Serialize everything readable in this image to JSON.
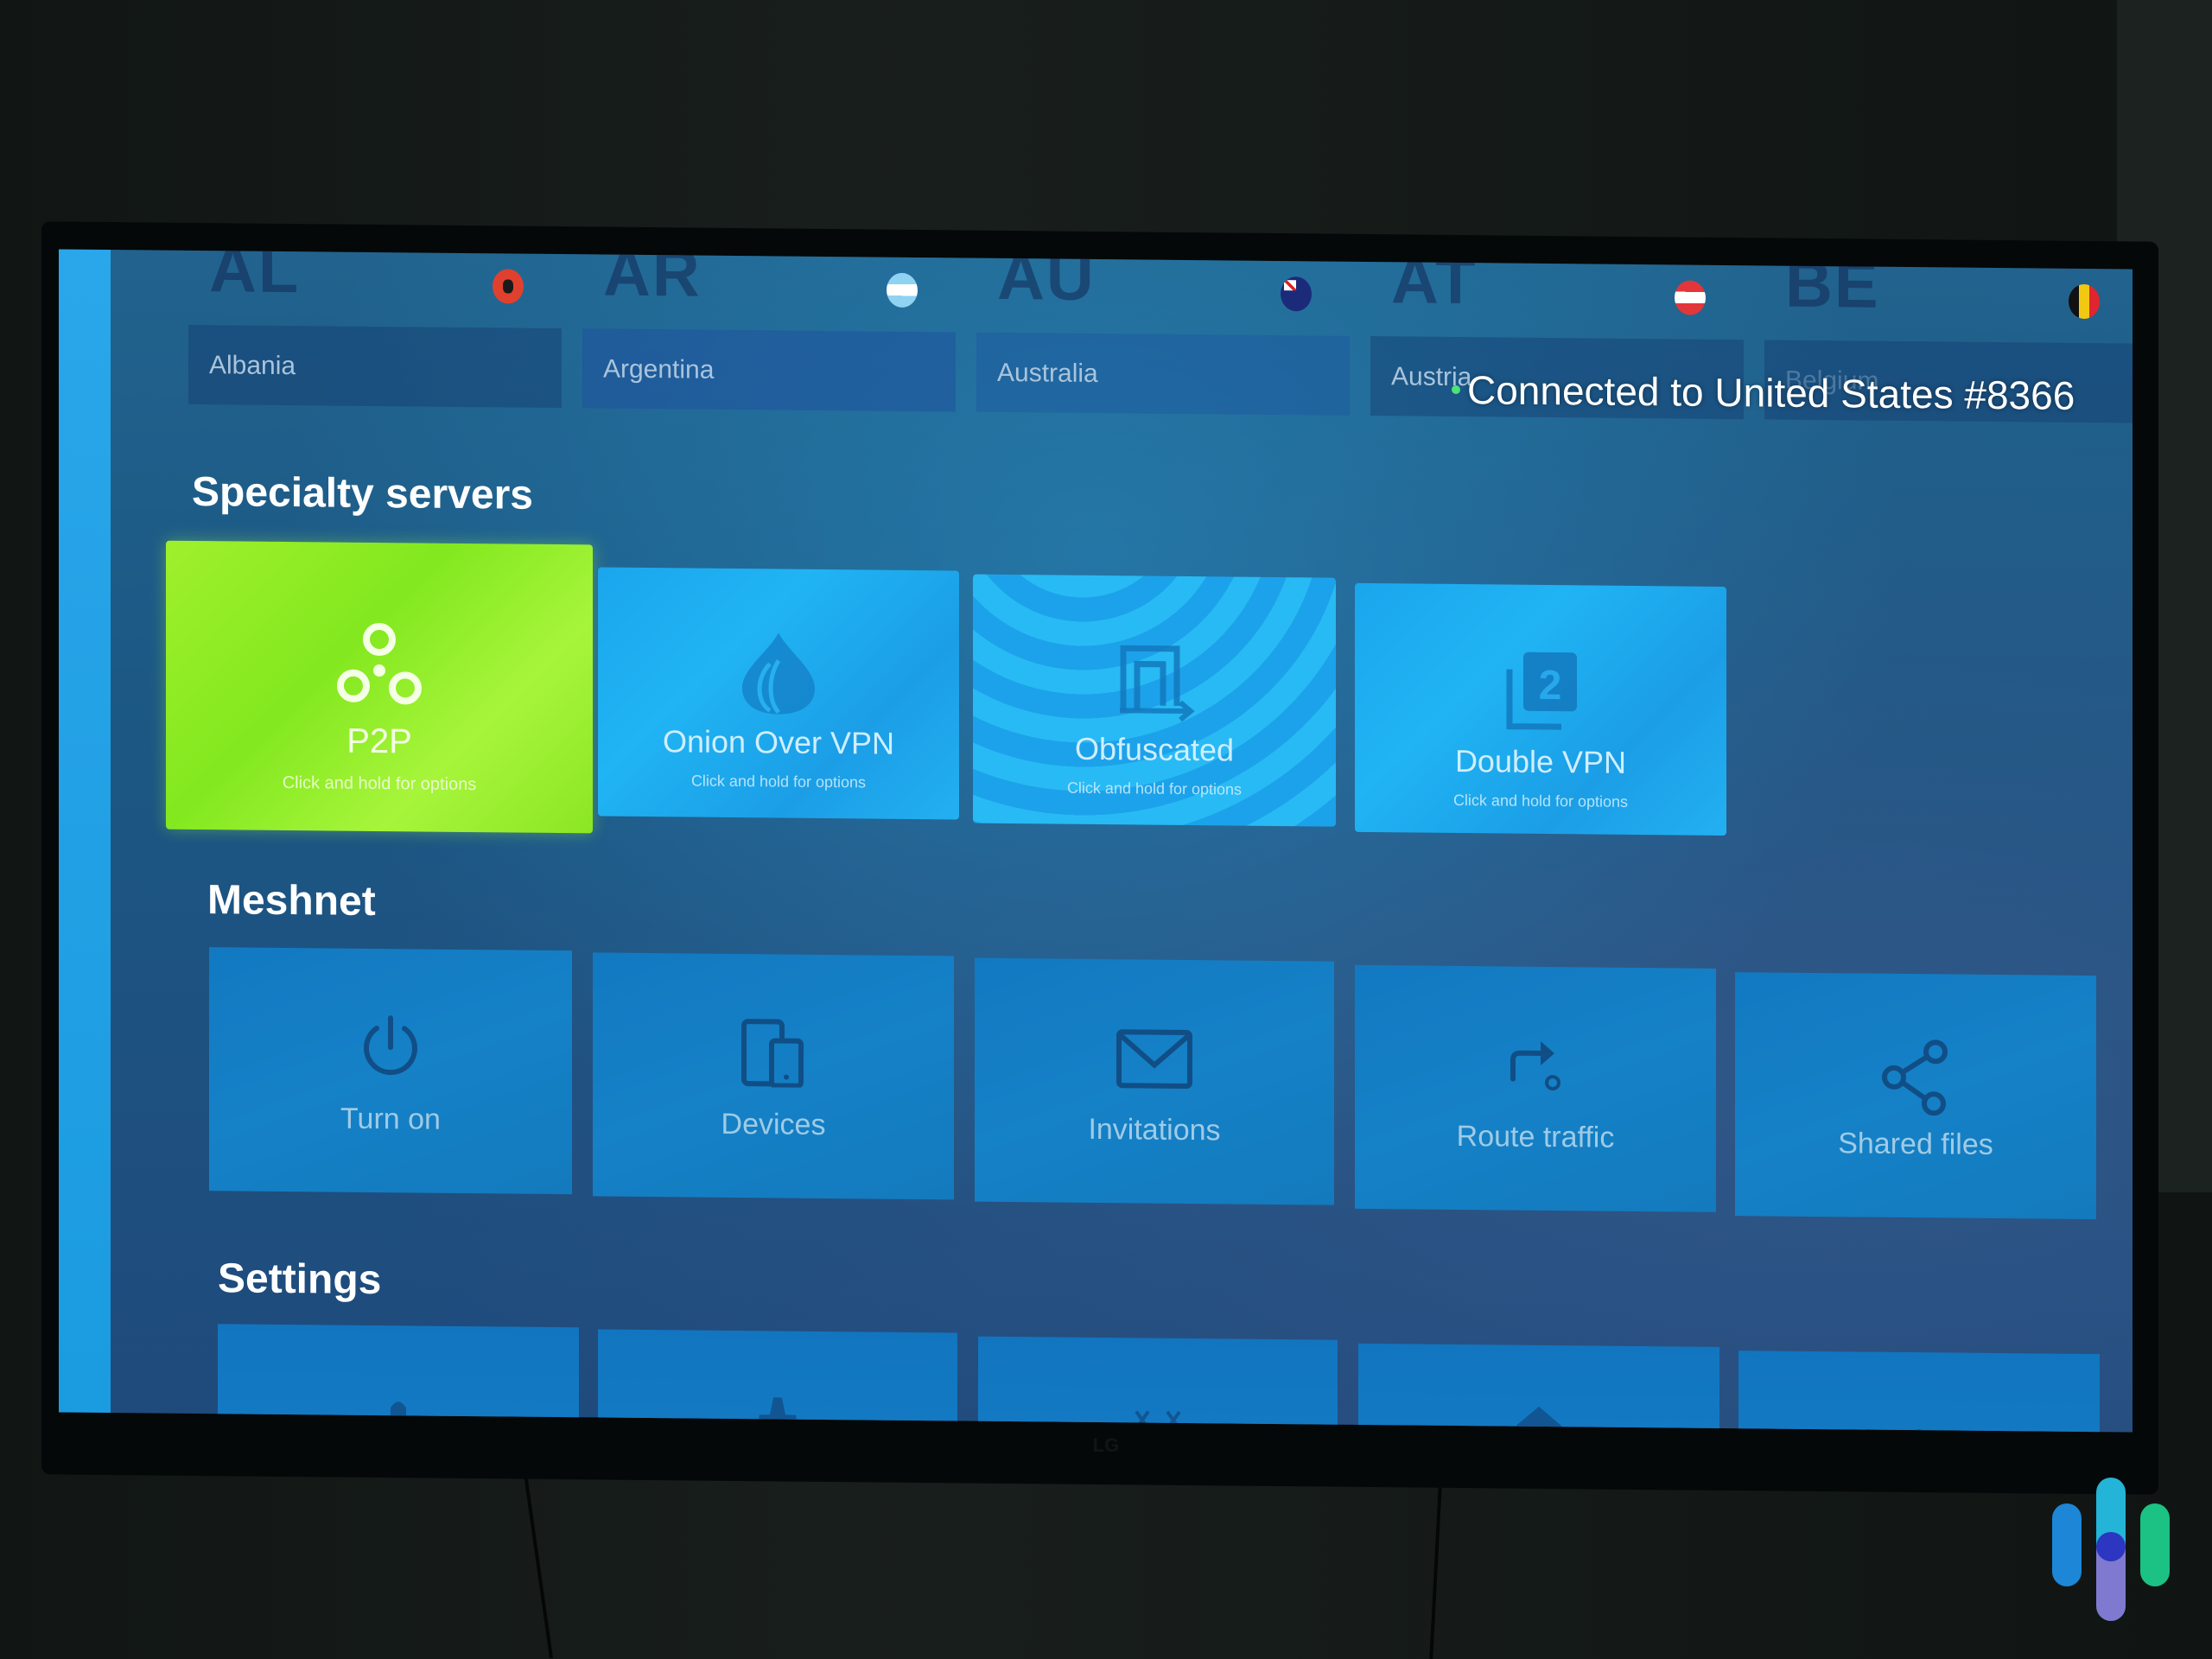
{
  "countries": [
    {
      "code": "AL",
      "name": "Albania"
    },
    {
      "code": "AR",
      "name": "Argentina"
    },
    {
      "code": "AU",
      "name": "Australia"
    },
    {
      "code": "AT",
      "name": "Austria"
    },
    {
      "code": "BE",
      "name": "Belgium"
    }
  ],
  "connection_status": "Connected to United States #8366",
  "specialty": {
    "title": "Specialty servers",
    "tiles": [
      {
        "title": "P2P",
        "hint": "Click and hold for options",
        "icon": "p2p-icon",
        "selected": true
      },
      {
        "title": "Onion Over VPN",
        "hint": "Click and hold for options",
        "icon": "onion-icon"
      },
      {
        "title": "Obfuscated",
        "hint": "Click and hold for options",
        "icon": "obfuscated-icon"
      },
      {
        "title": "Double VPN",
        "hint": "Click and hold for options",
        "icon": "double-vpn-icon"
      }
    ]
  },
  "meshnet": {
    "title": "Meshnet",
    "tiles": [
      {
        "label": "Turn on",
        "icon": "power-icon"
      },
      {
        "label": "Devices",
        "icon": "devices-icon"
      },
      {
        "label": "Invitations",
        "icon": "envelope-icon"
      },
      {
        "label": "Route traffic",
        "icon": "route-arrow-icon"
      },
      {
        "label": "Shared files",
        "icon": "share-icon"
      }
    ]
  },
  "settings": {
    "title": "Settings"
  },
  "colors": {
    "selected_tile": "#8be624",
    "specialty_tile": "#1ba6ec",
    "meshnet_tile": "#1581c7",
    "accent_strip": "#2aa6ea",
    "status_dot": "#4de27a"
  }
}
